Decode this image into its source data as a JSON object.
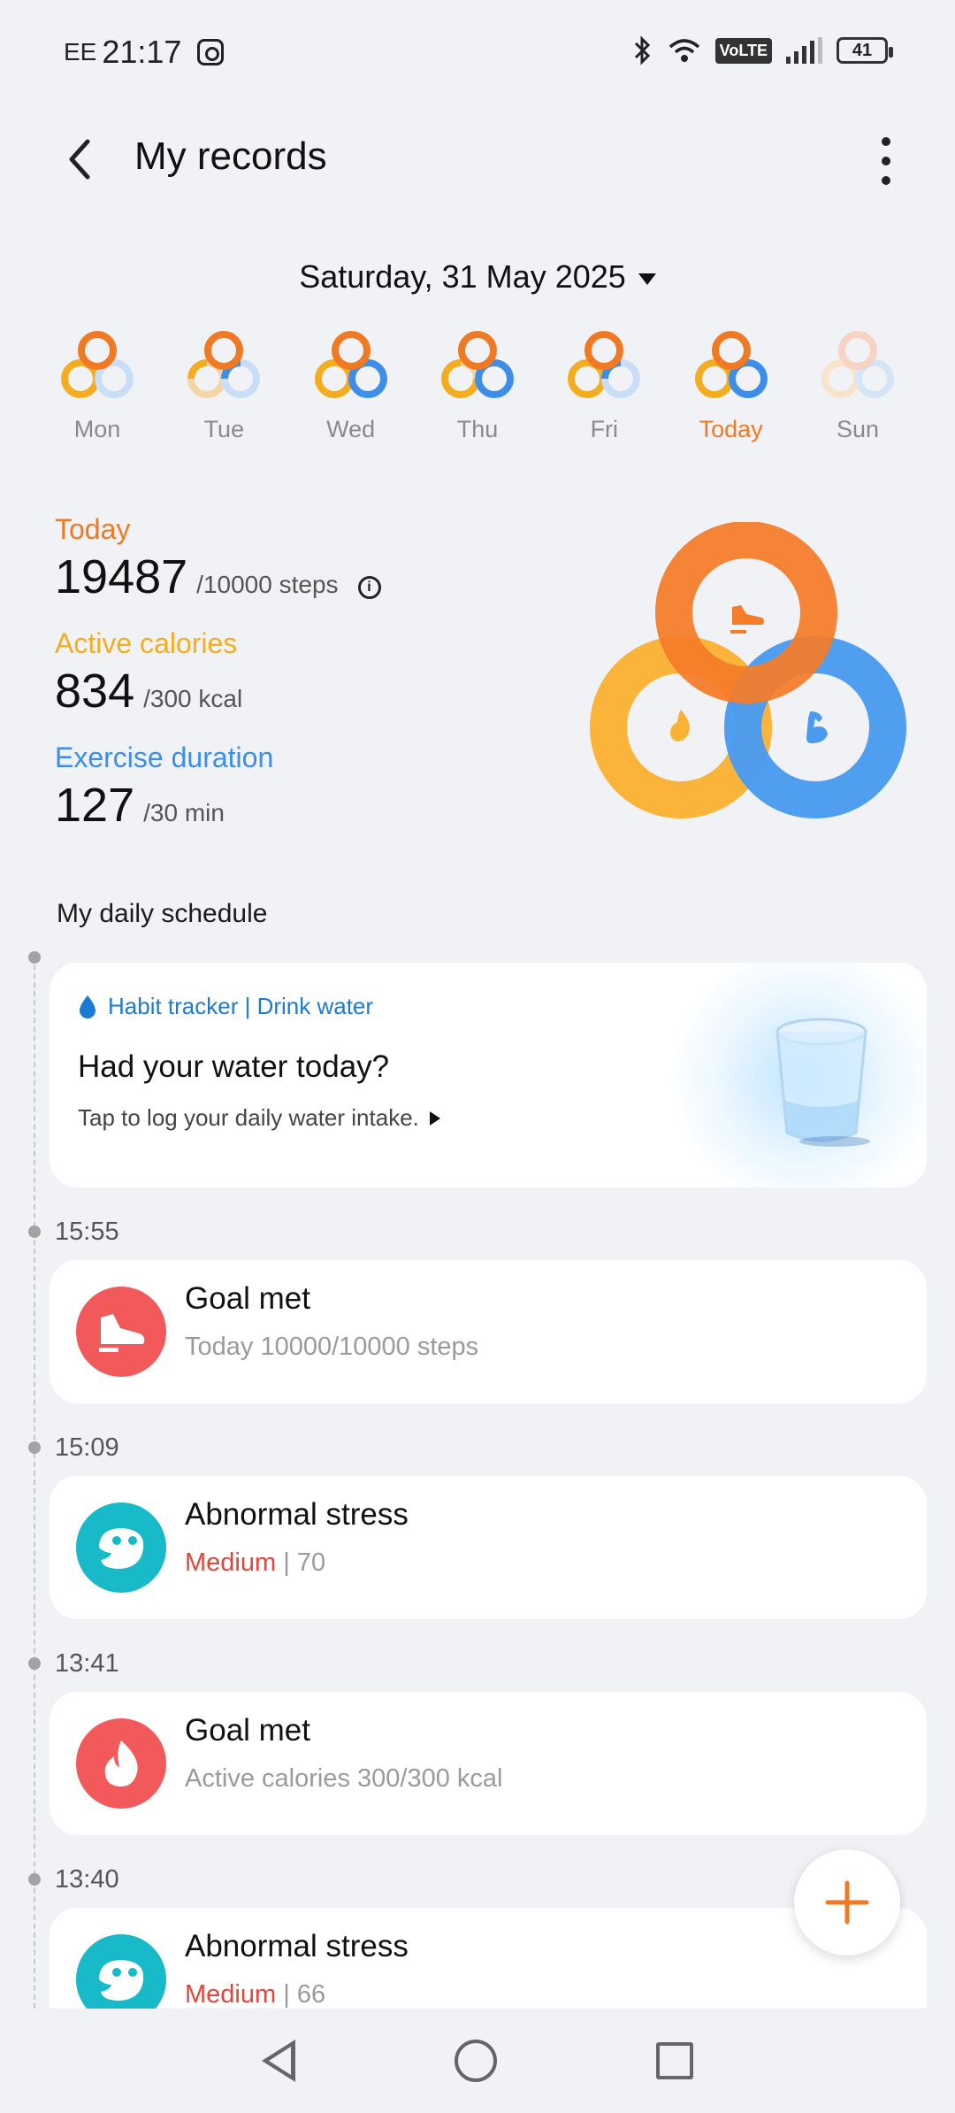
{
  "status_bar": {
    "carrier": "EE",
    "time": "21:17",
    "network": "VoLTE",
    "battery": "41"
  },
  "header": {
    "title": "My records"
  },
  "date_picker": {
    "label": "Saturday, 31 May 2025"
  },
  "week": [
    {
      "label": "Mon"
    },
    {
      "label": "Tue"
    },
    {
      "label": "Wed"
    },
    {
      "label": "Thu"
    },
    {
      "label": "Fri"
    },
    {
      "label": "Today"
    },
    {
      "label": "Sun"
    }
  ],
  "summary": {
    "steps": {
      "label": "Today",
      "value": "19487",
      "goal": "/10000 steps",
      "color": "#f07a24"
    },
    "calories": {
      "label": "Active calories",
      "value": "834",
      "goal": "/300 kcal",
      "color": "#f5ad20"
    },
    "exercise": {
      "label": "Exercise duration",
      "value": "127",
      "goal": "/30 min",
      "color": "#3c8ee8"
    }
  },
  "schedule": {
    "title": "My daily schedule",
    "water_card": {
      "tag": "Habit tracker | Drink water",
      "title": "Had your water today?",
      "subtitle": "Tap to log your daily water intake."
    },
    "events": [
      {
        "time": "15:55",
        "title": "Goal met",
        "subtitle": "Today 10000/10000 steps",
        "icon": "shoe-icon",
        "color": "#f2595a"
      },
      {
        "time": "15:09",
        "title": "Abnormal stress",
        "level": "Medium",
        "sep": " | ",
        "value": "70",
        "icon": "stress-face-icon",
        "color": "#18b9c8"
      },
      {
        "time": "13:41",
        "title": "Goal met",
        "subtitle": "Active calories 300/300 kcal",
        "icon": "flame-icon",
        "color": "#f2595a"
      },
      {
        "time": "13:40",
        "title": "Abnormal stress",
        "level": "Medium",
        "sep": " | ",
        "value": "66",
        "icon": "stress-face-icon",
        "color": "#18b9c8"
      }
    ]
  }
}
